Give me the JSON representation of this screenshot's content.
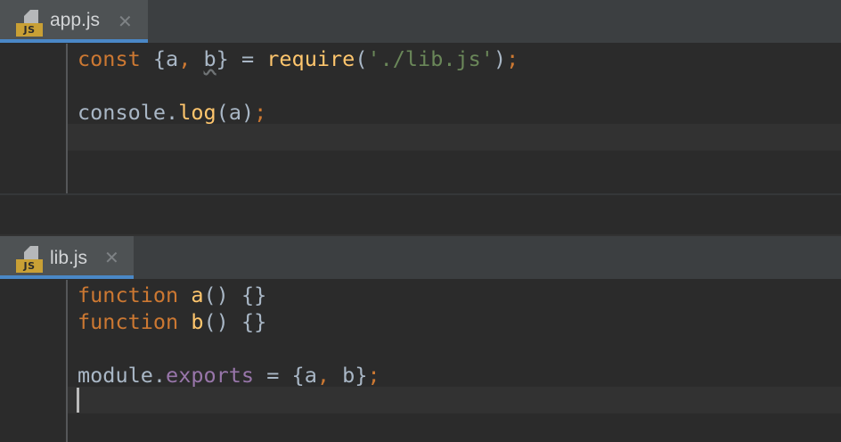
{
  "top_pane": {
    "tab": {
      "label": "app.js",
      "icon": "js-file-icon",
      "badge": "JS",
      "close": "✕"
    },
    "lines": [
      {
        "tokens": [
          {
            "text": "const",
            "kind": "kw"
          },
          {
            "text": " {",
            "kind": "plain"
          },
          {
            "text": "a",
            "kind": "plain"
          },
          {
            "text": ",",
            "kind": "punc"
          },
          {
            "text": " ",
            "kind": "plain"
          },
          {
            "text": "b",
            "kind": "unused"
          },
          {
            "text": "} = ",
            "kind": "plain"
          },
          {
            "text": "require",
            "kind": "fn"
          },
          {
            "text": "(",
            "kind": "plain"
          },
          {
            "text": "'./lib.js'",
            "kind": "str"
          },
          {
            "text": ")",
            "kind": "plain"
          },
          {
            "text": ";",
            "kind": "punc"
          }
        ]
      },
      {
        "tokens": []
      },
      {
        "tokens": [
          {
            "text": "console",
            "kind": "plain"
          },
          {
            "text": ".",
            "kind": "plain"
          },
          {
            "text": "log",
            "kind": "fn"
          },
          {
            "text": "(",
            "kind": "plain"
          },
          {
            "text": "a",
            "kind": "plain"
          },
          {
            "text": ")",
            "kind": "plain"
          },
          {
            "text": ";",
            "kind": "punc"
          }
        ]
      }
    ]
  },
  "bottom_pane": {
    "tab": {
      "label": "lib.js",
      "icon": "js-file-icon",
      "badge": "JS",
      "close": "✕"
    },
    "lines": [
      {
        "tokens": [
          {
            "text": "function",
            "kind": "kw"
          },
          {
            "text": " ",
            "kind": "plain"
          },
          {
            "text": "a",
            "kind": "fn"
          },
          {
            "text": "() {}",
            "kind": "plain"
          }
        ]
      },
      {
        "tokens": [
          {
            "text": "function",
            "kind": "kw"
          },
          {
            "text": " ",
            "kind": "plain"
          },
          {
            "text": "b",
            "kind": "fn"
          },
          {
            "text": "() {}",
            "kind": "plain"
          }
        ]
      },
      {
        "tokens": []
      },
      {
        "tokens": [
          {
            "text": "module",
            "kind": "plain"
          },
          {
            "text": ".",
            "kind": "plain"
          },
          {
            "text": "exports",
            "kind": "prop"
          },
          {
            "text": " = {",
            "kind": "plain"
          },
          {
            "text": "a",
            "kind": "plain"
          },
          {
            "text": ",",
            "kind": "punc"
          },
          {
            "text": " ",
            "kind": "plain"
          },
          {
            "text": "b",
            "kind": "plain"
          },
          {
            "text": "}",
            "kind": "plain"
          },
          {
            "text": ";",
            "kind": "punc"
          }
        ]
      }
    ]
  },
  "colors": {
    "keyword": "#cc7832",
    "function": "#ffc66d",
    "string": "#6a8759",
    "property": "#9876aa",
    "plain": "#a9b7c6",
    "background": "#2b2b2b",
    "active_tab_underline": "#4a88c7"
  }
}
